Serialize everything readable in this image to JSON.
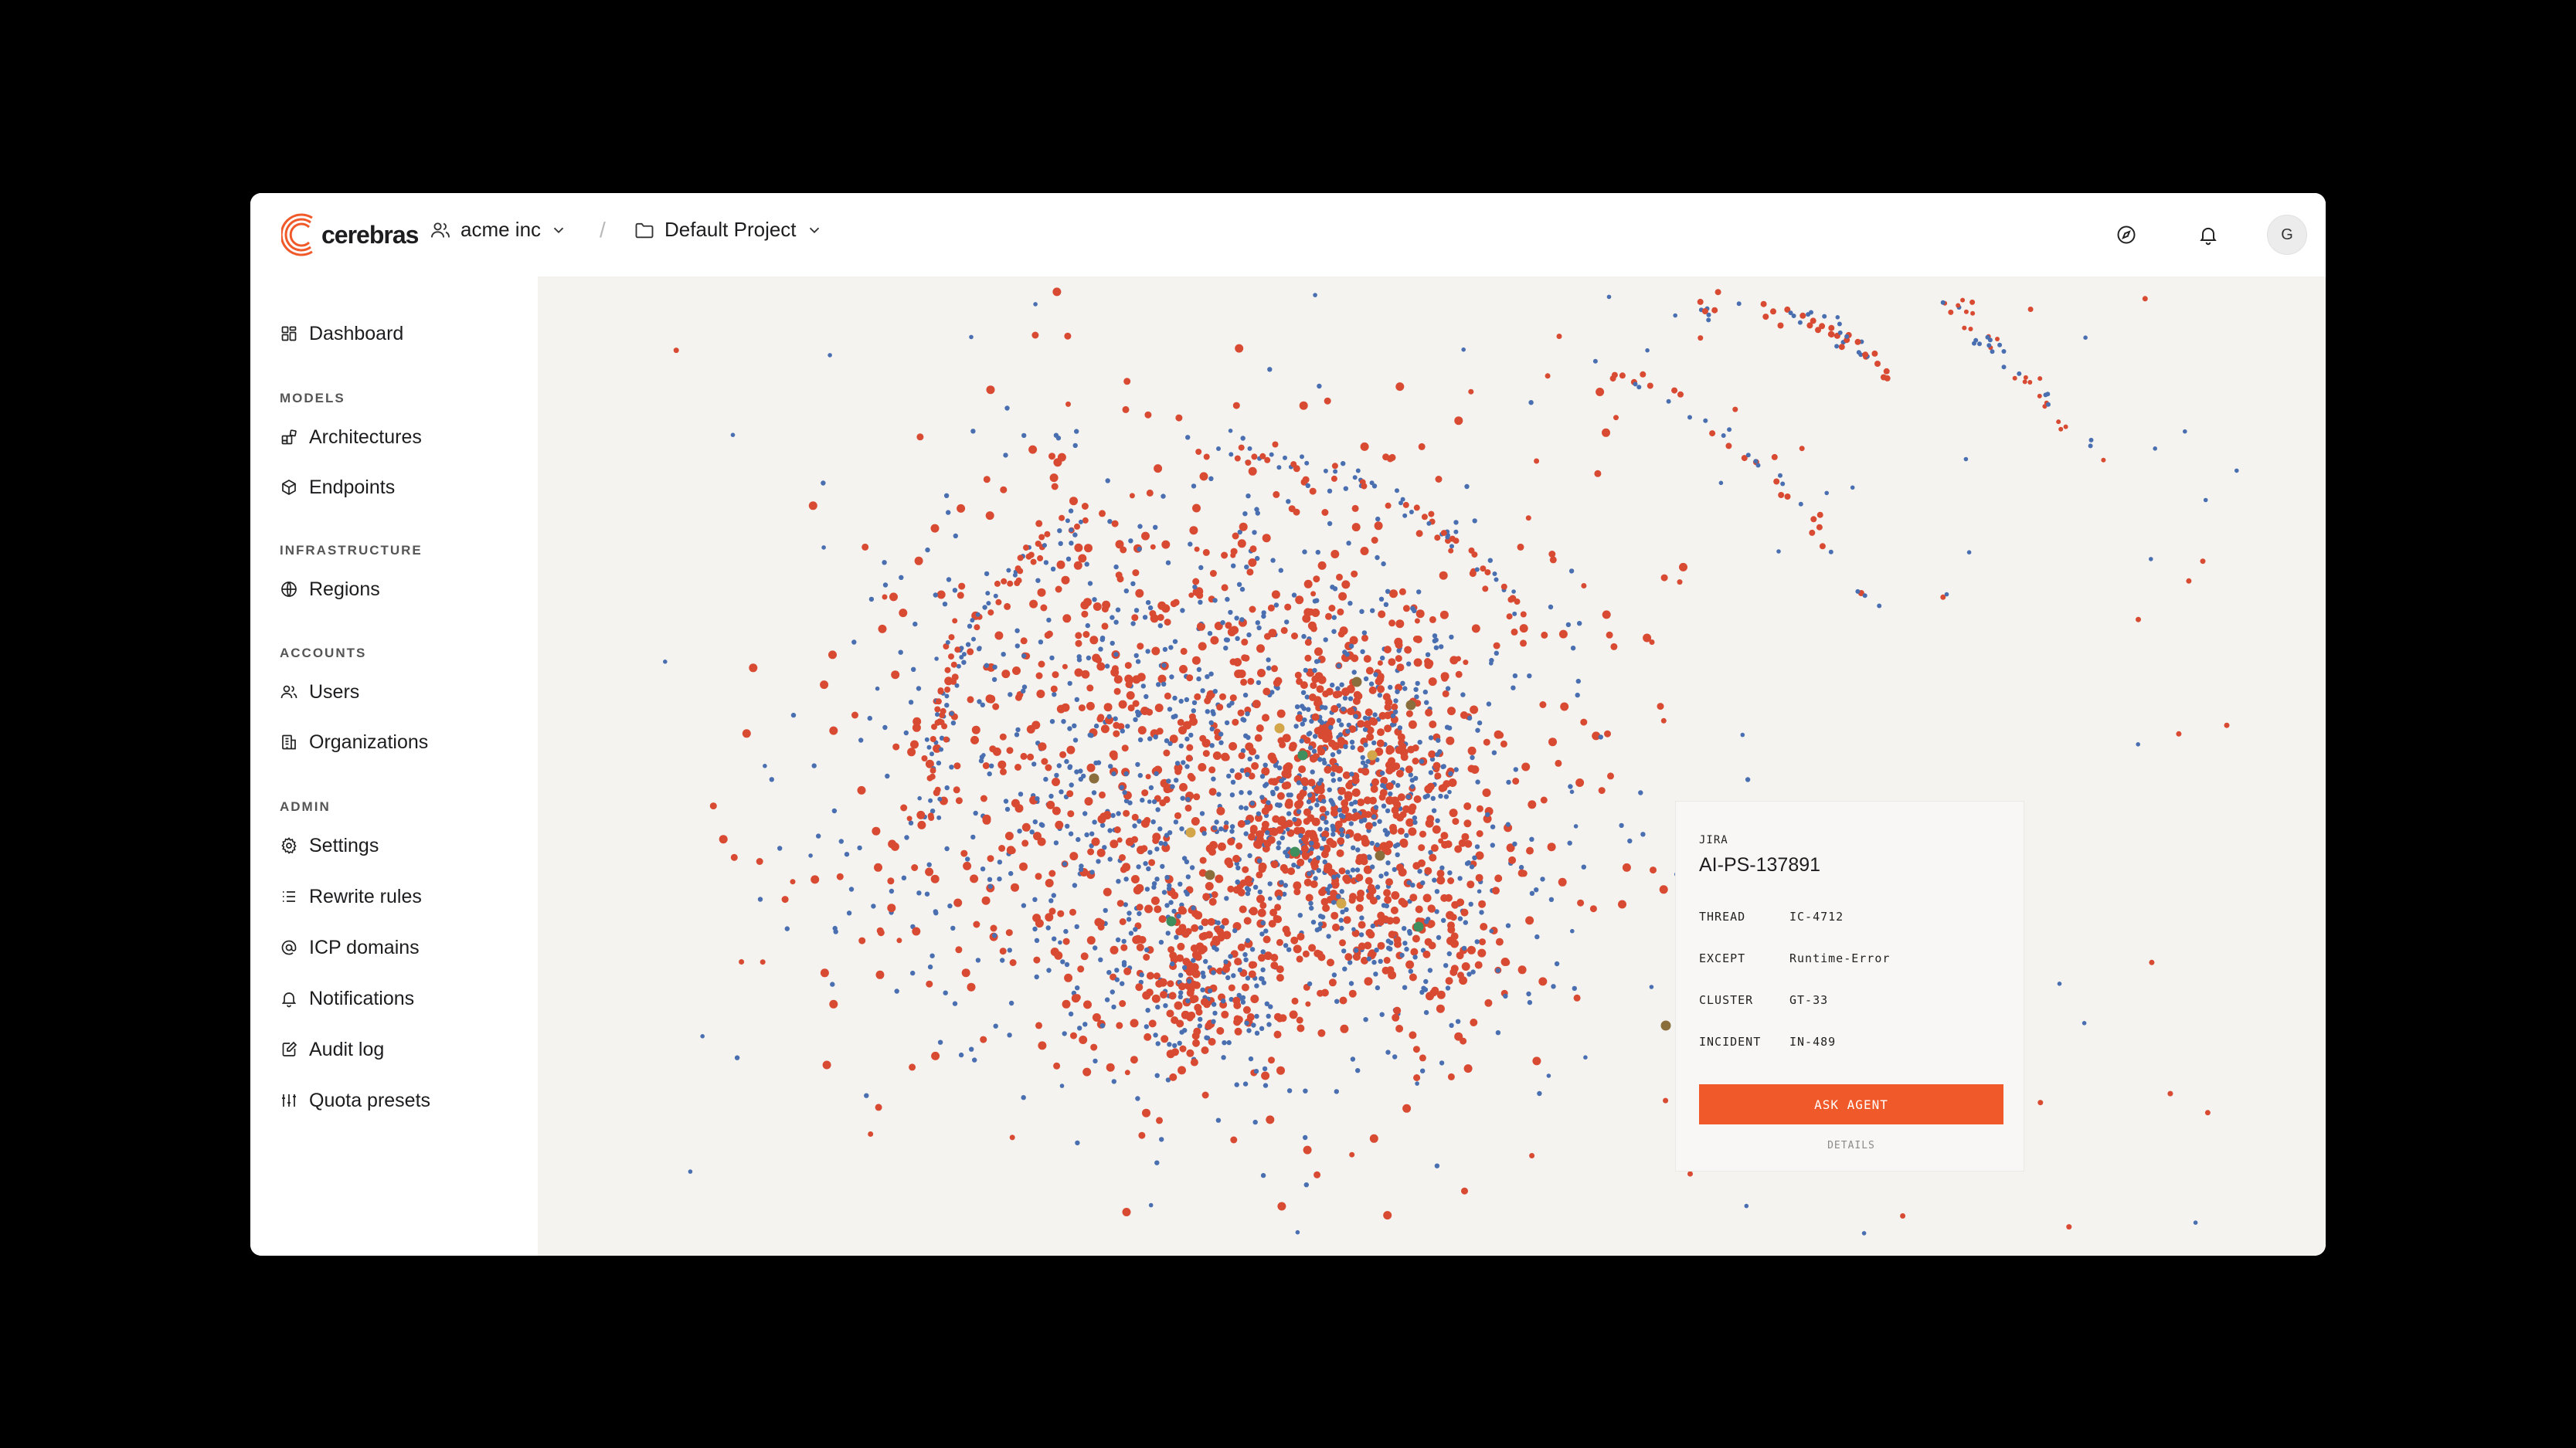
{
  "brand": {
    "name": "cerebras",
    "accent": "#f05a2a"
  },
  "header": {
    "org": "acme inc",
    "separator": "/",
    "project": "Default Project",
    "avatar_initial": "G",
    "icons": [
      "compass-icon",
      "bell-icon"
    ]
  },
  "sidebar": {
    "dashboard": "Dashboard",
    "sections": {
      "models": "MODELS",
      "infrastructure": "INFRASTRUCTURE",
      "accounts": "ACCOUNTS",
      "admin": "ADMIN"
    },
    "items": {
      "architectures": "Architectures",
      "endpoints": "Endpoints",
      "regions": "Regions",
      "users": "Users",
      "organizations": "Organizations",
      "settings": "Settings",
      "rewrite_rules": "Rewrite rules",
      "icp_domains": "ICP domains",
      "notifications": "Notifications",
      "audit_log": "Audit log",
      "quota_presets": "Quota presets"
    }
  },
  "graph": {
    "colors": {
      "red": "#d94a32",
      "blue": "#4a6fb0",
      "olive": "#8a6e3c",
      "gold": "#d4a64a",
      "green": "#3f8e5e",
      "background": "#f4f3f0"
    }
  },
  "popup": {
    "source": "JIRA",
    "title": "AI-PS-137891",
    "fields": [
      {
        "key": "THREAD",
        "value": "IC-4712"
      },
      {
        "key": "EXCEPT",
        "value": "Runtime-Error"
      },
      {
        "key": "CLUSTER",
        "value": "GT-33"
      },
      {
        "key": "INCIDENT",
        "value": "IN-489"
      }
    ],
    "cta_label": "ASK AGENT",
    "details_label": "DETAILS"
  }
}
